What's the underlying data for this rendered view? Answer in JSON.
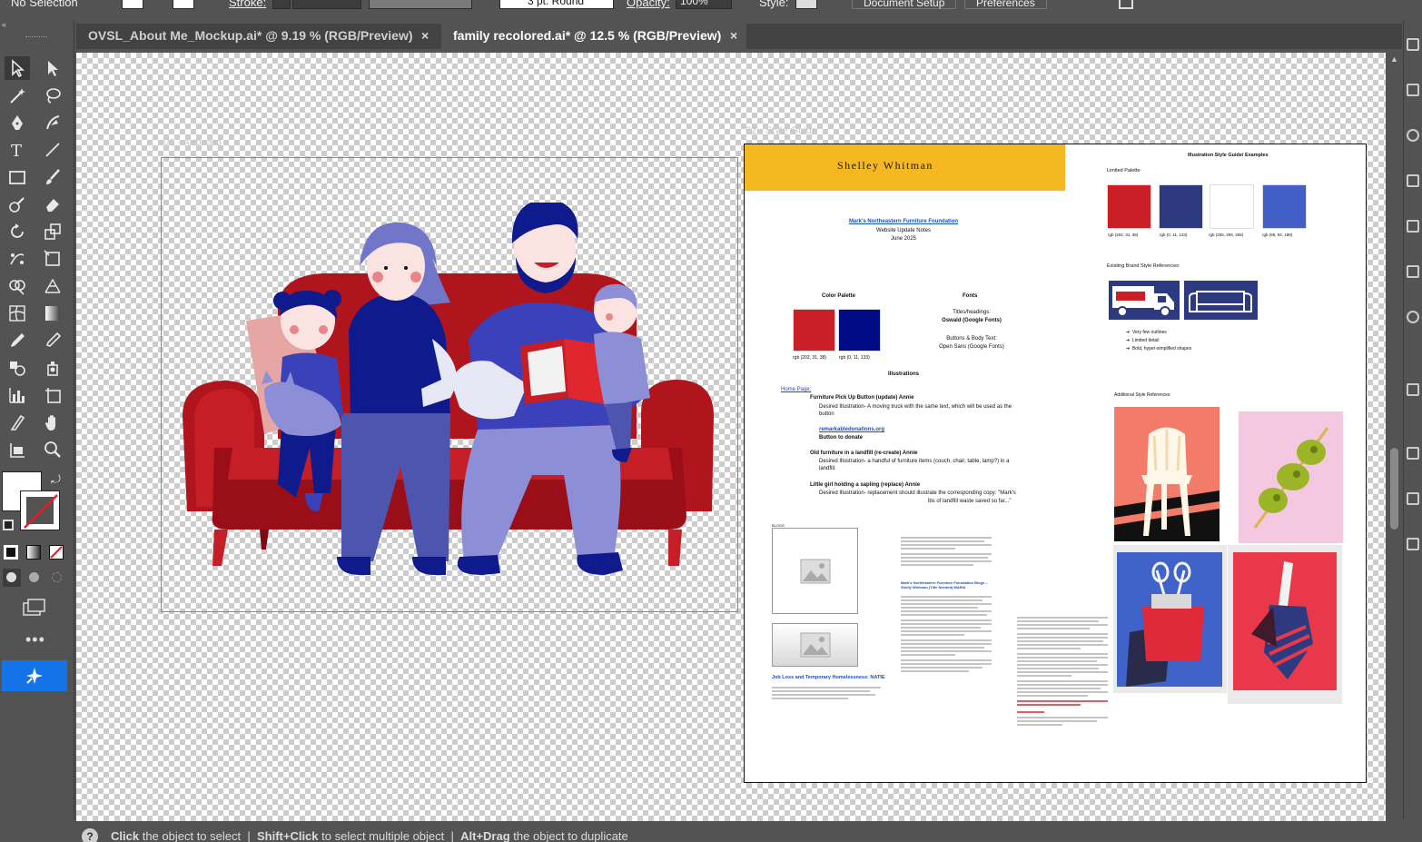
{
  "control_bar": {
    "selection": "No Selection",
    "stroke_label": "Stroke:",
    "brush": "3 pt. Round",
    "opacity_label": "Opacity:",
    "opacity_value": "100%",
    "style_label": "Style:",
    "document_setup": "Document Setup",
    "preferences": "Preferences"
  },
  "tabs": [
    {
      "title": "OVSL_About Me_Mockup.ai* @ 9.19 % (RGB/Preview)",
      "active": false
    },
    {
      "title": "family recolored.ai* @ 12.5 % (RGB/Preview)",
      "active": true
    }
  ],
  "tab_close": "×",
  "artboards": {
    "left_label": "01 - Artboard",
    "right_label": "02 - Style Guide"
  },
  "style_guide": {
    "logo_text": "Shelley Whitman",
    "link_title": "Mark's Northeastern Furniture Foundation",
    "subtitle": "Website Update Notes",
    "date": "June 2025",
    "color_palette_heading": "Color Palette",
    "fonts_heading": "Fonts",
    "titles_label": "Titles/headings:",
    "titles_font": "Oswald (Google Fonts)",
    "buttons_label": "Buttons & Body Text:",
    "buttons_font": "Open Sans (Google Fonts)",
    "palette_labels": [
      "rgb (202, 31, 38)",
      "rgb (0, 11, 133)"
    ],
    "illustrations_heading": "Illustrations",
    "home_page": "Home Page:",
    "item1_title": "Furniture Pick Up Button (update) Annie",
    "item1_desc": "Desired Illustration- A moving truck with the same text, which will be used as the button",
    "item1_link": "remarkabledonations.org",
    "item1_link2": "Button to donate",
    "item2_title": "Old furniture in a landfill (re-create) Annie",
    "item2_desc": "Desired Illustration- a handful of furniture items (couch, chair, table, lamp?) in a landfill.",
    "item3_title": "Little girl holding a sapling (replace) Annie",
    "item3_desc": "Desired Illustration- replacement should illustrate the corresponding copy: \"Mark's",
    "item3_desc2": "lbs of landfill waste saved so far...\"",
    "blogs_label": "BLOGS",
    "blog_link": "Mark's Northeastern Furniture Foundation Blogs – Shelly Whitman (Title Needed) MARIA",
    "job_loss_heading": "Job Loss and Temporary Homelessness: NATIE",
    "guide_heading": "Illustration Style Guide/ Examples",
    "limited_palette_label": "Limited Palette:",
    "limited_palette": [
      {
        "label": "rgb (202, 31, 38)",
        "color": "#ca1f26"
      },
      {
        "label": "rgb (0, 11, 133)",
        "color": "#2e3a80"
      },
      {
        "label": "rgb (255, 255, 255)",
        "color": "#ffffff"
      },
      {
        "label": "rgb (68, 94, 199)",
        "color": "#445ec7"
      }
    ],
    "existing_refs_label": "Existing Brand Style References:",
    "bullets": [
      "Very few outlines",
      "Limited detail",
      "Bold, hyper-simplified shapes"
    ],
    "additional_refs_label": "Additional Style References:"
  },
  "status_bar": {
    "help": "?",
    "hint1_key": "Click",
    "hint1": "the object to select",
    "hint2_key": "Shift+Click",
    "hint2": "to select multiple object",
    "hint3_key": "Alt+Drag",
    "hint3": "the object to duplicate",
    "separator": "|"
  },
  "colors": {
    "app_bg": "#535353",
    "tab_bg": "#424242",
    "accent_blue": "#1473e6",
    "couch_red": "#b0151d",
    "navy": "#0f1a8c",
    "lavender": "#8d8fd6",
    "banner_yellow": "#f5b821"
  }
}
